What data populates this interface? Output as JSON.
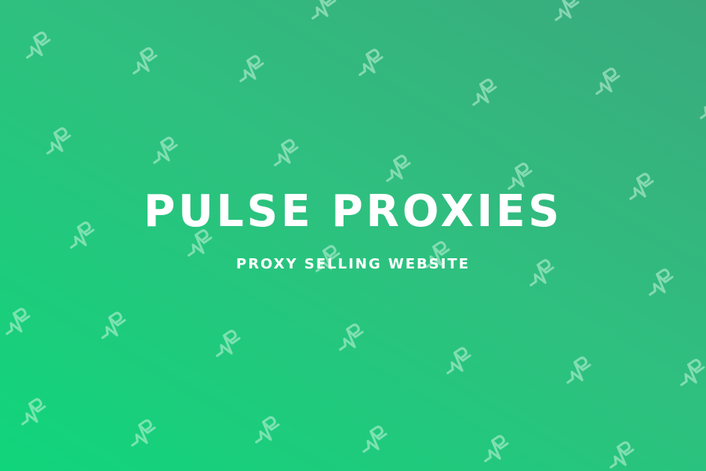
{
  "brand": {
    "title": "PULSE PROXIES",
    "subtitle": "PROXY SELLING WEBSITE"
  },
  "colors": {
    "gradient_top_right": "#3aaa7d",
    "gradient_bottom_left": "#10d57b",
    "text": "#ffffff",
    "pattern_mark": "#c8f5dc"
  },
  "pattern": {
    "icon": "pulse-proxies-logo-icon"
  }
}
